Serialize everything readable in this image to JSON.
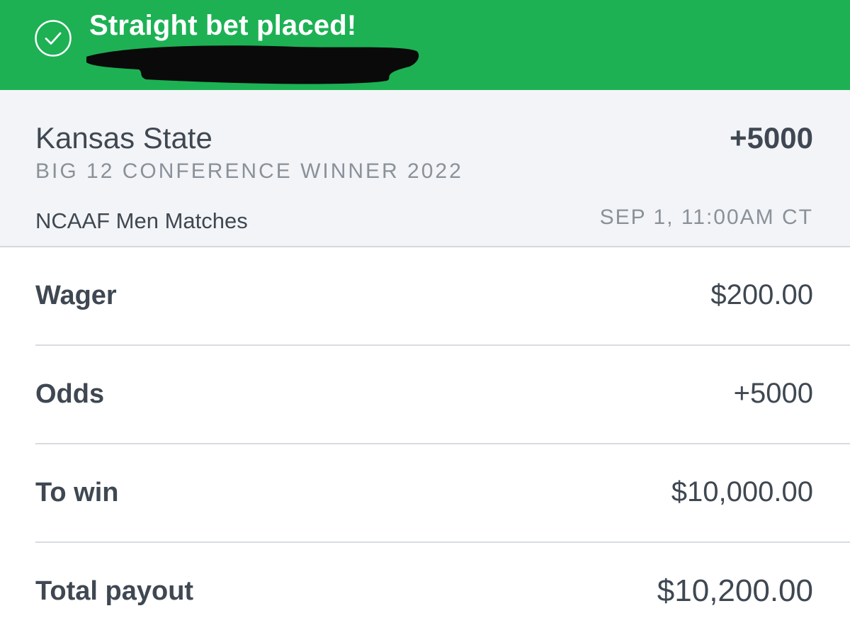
{
  "banner": {
    "icon": "check-circle-icon",
    "title": "Straight bet placed!",
    "color": "#1db154"
  },
  "bet": {
    "selection": "Kansas State",
    "odds": "+5000",
    "market": "BIG 12 CONFERENCE WINNER 2022",
    "league": "NCAAF Men Matches",
    "datetime": "SEP 1, 11:00AM CT"
  },
  "details": {
    "wager": {
      "label": "Wager",
      "value": "$200.00"
    },
    "odds": {
      "label": "Odds",
      "value": "+5000"
    },
    "to_win": {
      "label": "To win",
      "value": "$10,000.00"
    },
    "total_payout": {
      "label": "Total payout",
      "value": "$10,200.00"
    }
  }
}
